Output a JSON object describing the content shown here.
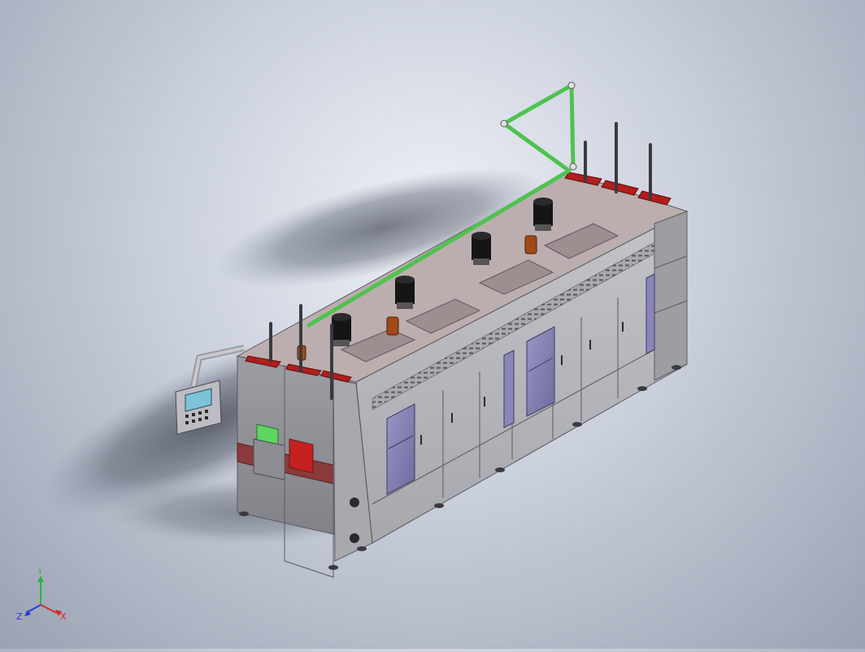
{
  "viewport": {
    "background_top": "#eef1f7",
    "background_bottom": "#9aa2b3"
  },
  "model": {
    "frame_color": "#b3b3b8",
    "panel_color": "#c9c9cf",
    "door_color": "#8a87b8",
    "top_plate_color": "#b9a7a7",
    "red_accent_color": "#b31d1d",
    "pipe_color": "#5fd65f",
    "motor_color": "#151515",
    "bronze_color": "#a04a16",
    "hmi_screen_color": "#7cc2d8",
    "motor_count": 4,
    "operator_panel": "hmi-control-panel"
  },
  "triad": {
    "x_label": "X",
    "y_label": "Y",
    "z_label": "Z",
    "x_color": "#d8262c",
    "y_color": "#2bb34a",
    "z_color": "#2c3bd8"
  }
}
